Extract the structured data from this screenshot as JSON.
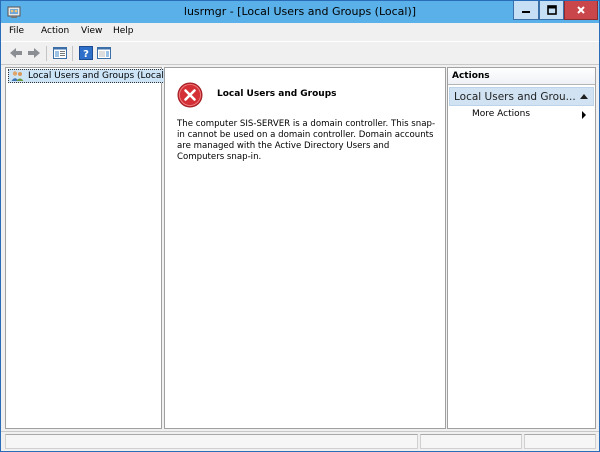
{
  "window": {
    "title": "lusrmgr - [Local Users and Groups (Local)]",
    "app_icon": "lusrmgr-icon",
    "controls": [
      "minimize-icon",
      "maximize-icon",
      "close-icon"
    ],
    "accent_color": "#5ab0e8",
    "close_color": "#c9464a"
  },
  "menu": {
    "file": "File",
    "action": "Action",
    "view": "View",
    "help": "Help"
  },
  "toolbar": {
    "icons": [
      "back-arrow-icon",
      "forward-arrow-icon",
      "show-hide-console-tree-icon",
      "help-icon",
      "show-hide-action-pane-icon"
    ]
  },
  "tree": {
    "root_label": "Local Users and Groups (Local)",
    "root_icon": "users-groups-icon"
  },
  "main": {
    "error_icon": "error-icon",
    "error_title": "Local Users and Groups",
    "error_message": "The computer SIS-SERVER is a domain controller. This snap-in cannot be used on a domain controller. Domain accounts are managed with the Active Directory Users and Computers snap-in."
  },
  "actions": {
    "header": "Actions",
    "group_label": "Local Users and Grou...",
    "more_actions": "More Actions"
  }
}
